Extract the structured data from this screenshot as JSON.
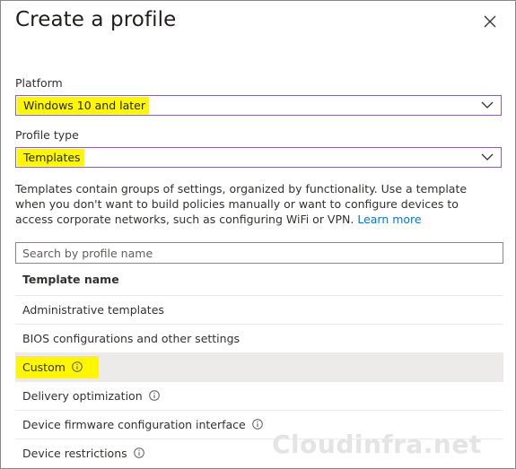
{
  "dialog": {
    "title": "Create a profile",
    "close_icon": "close-icon"
  },
  "platform": {
    "label": "Platform",
    "value": "Windows 10 and later"
  },
  "profile_type": {
    "label": "Profile type",
    "value": "Templates"
  },
  "description": {
    "text": "Templates contain groups of settings, organized by functionality. Use a template when you don't want to build policies manually or want to configure devices to access corporate networks, such as configuring WiFi or VPN.",
    "link": "Learn more"
  },
  "search": {
    "placeholder": "Search by profile name"
  },
  "table": {
    "header": "Template name",
    "rows": [
      {
        "name": "Administrative templates",
        "info": false,
        "selected": false
      },
      {
        "name": "BIOS configurations and other settings",
        "info": false,
        "selected": false
      },
      {
        "name": "Custom",
        "info": true,
        "selected": true
      },
      {
        "name": "Delivery optimization",
        "info": true,
        "selected": false
      },
      {
        "name": "Device firmware configuration interface",
        "info": true,
        "selected": false
      },
      {
        "name": "Device restrictions",
        "info": true,
        "selected": false
      }
    ]
  },
  "watermark": "Cloudinfra.net",
  "colors": {
    "focus_border": "#8764b8",
    "highlight": "#fff700",
    "link": "#0078d4",
    "selected_row": "#edebe9"
  }
}
